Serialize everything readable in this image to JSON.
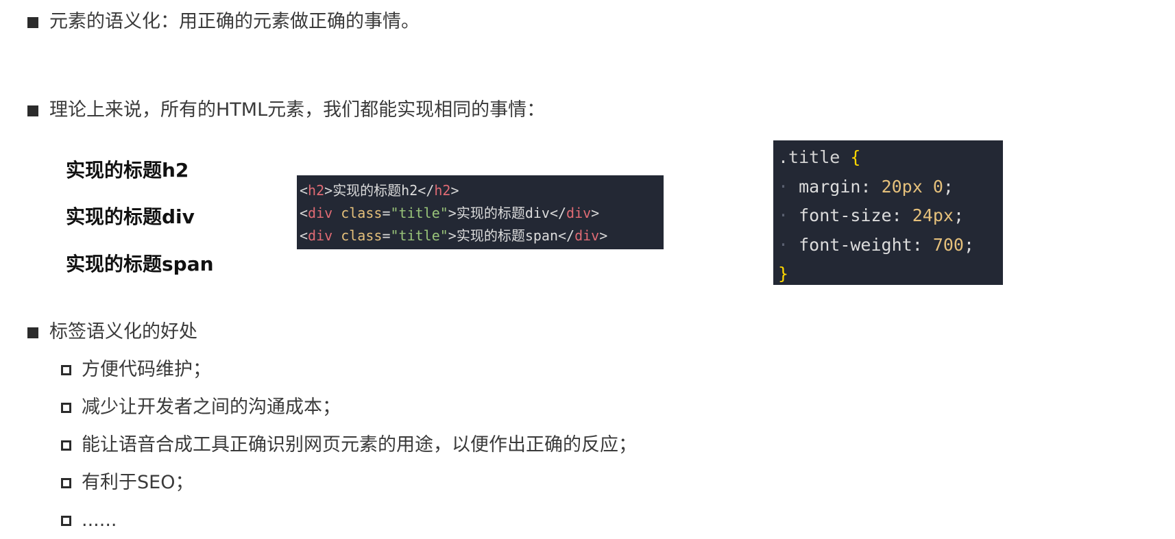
{
  "section1": {
    "text": "元素的语义化：用正确的元素做正确的事情。"
  },
  "section2": {
    "text": "理论上来说，所有的HTML元素，我们都能实现相同的事情："
  },
  "demo_titles": [
    "实现的标题h2",
    "实现的标题div",
    "实现的标题span"
  ],
  "html_code": {
    "line1": {
      "open_lt": "<",
      "open_tag": "h2",
      "open_gt": ">",
      "text": "实现的标题h2",
      "close_lt": "</",
      "close_tag": "h2",
      "close_gt": ">"
    },
    "line2": {
      "open_lt": "<",
      "open_tag": "div",
      "attr": "class",
      "eq": "=",
      "value": "\"title\"",
      "open_gt": ">",
      "text": "实现的标题div",
      "close_lt": "</",
      "close_tag": "div",
      "close_gt": ">"
    },
    "line3": {
      "open_lt": "<",
      "open_tag": "div",
      "attr": "class",
      "eq": "=",
      "value": "\"title\"",
      "open_gt": ">",
      "text": "实现的标题span",
      "close_lt": "</",
      "close_tag": "div",
      "close_gt": ">"
    }
  },
  "css_code": {
    "selector": ".title",
    "open_brace": "{",
    "close_brace": "}",
    "decl1": {
      "prop": "margin",
      "colon": ":",
      "value": "20px 0",
      "semi": ";"
    },
    "decl2": {
      "prop": "font-size",
      "colon": ":",
      "value": "24px",
      "semi": ";"
    },
    "decl3": {
      "prop": "font-weight",
      "colon": ":",
      "value": "700",
      "semi": ";"
    }
  },
  "section3": {
    "text": "标签语义化的好处",
    "items": [
      "方便代码维护；",
      "减少让开发者之间的沟通成本；",
      "能让语音合成工具正确识别网页元素的用途，以便作出正确的反应；",
      "有利于SEO；",
      "......"
    ]
  }
}
